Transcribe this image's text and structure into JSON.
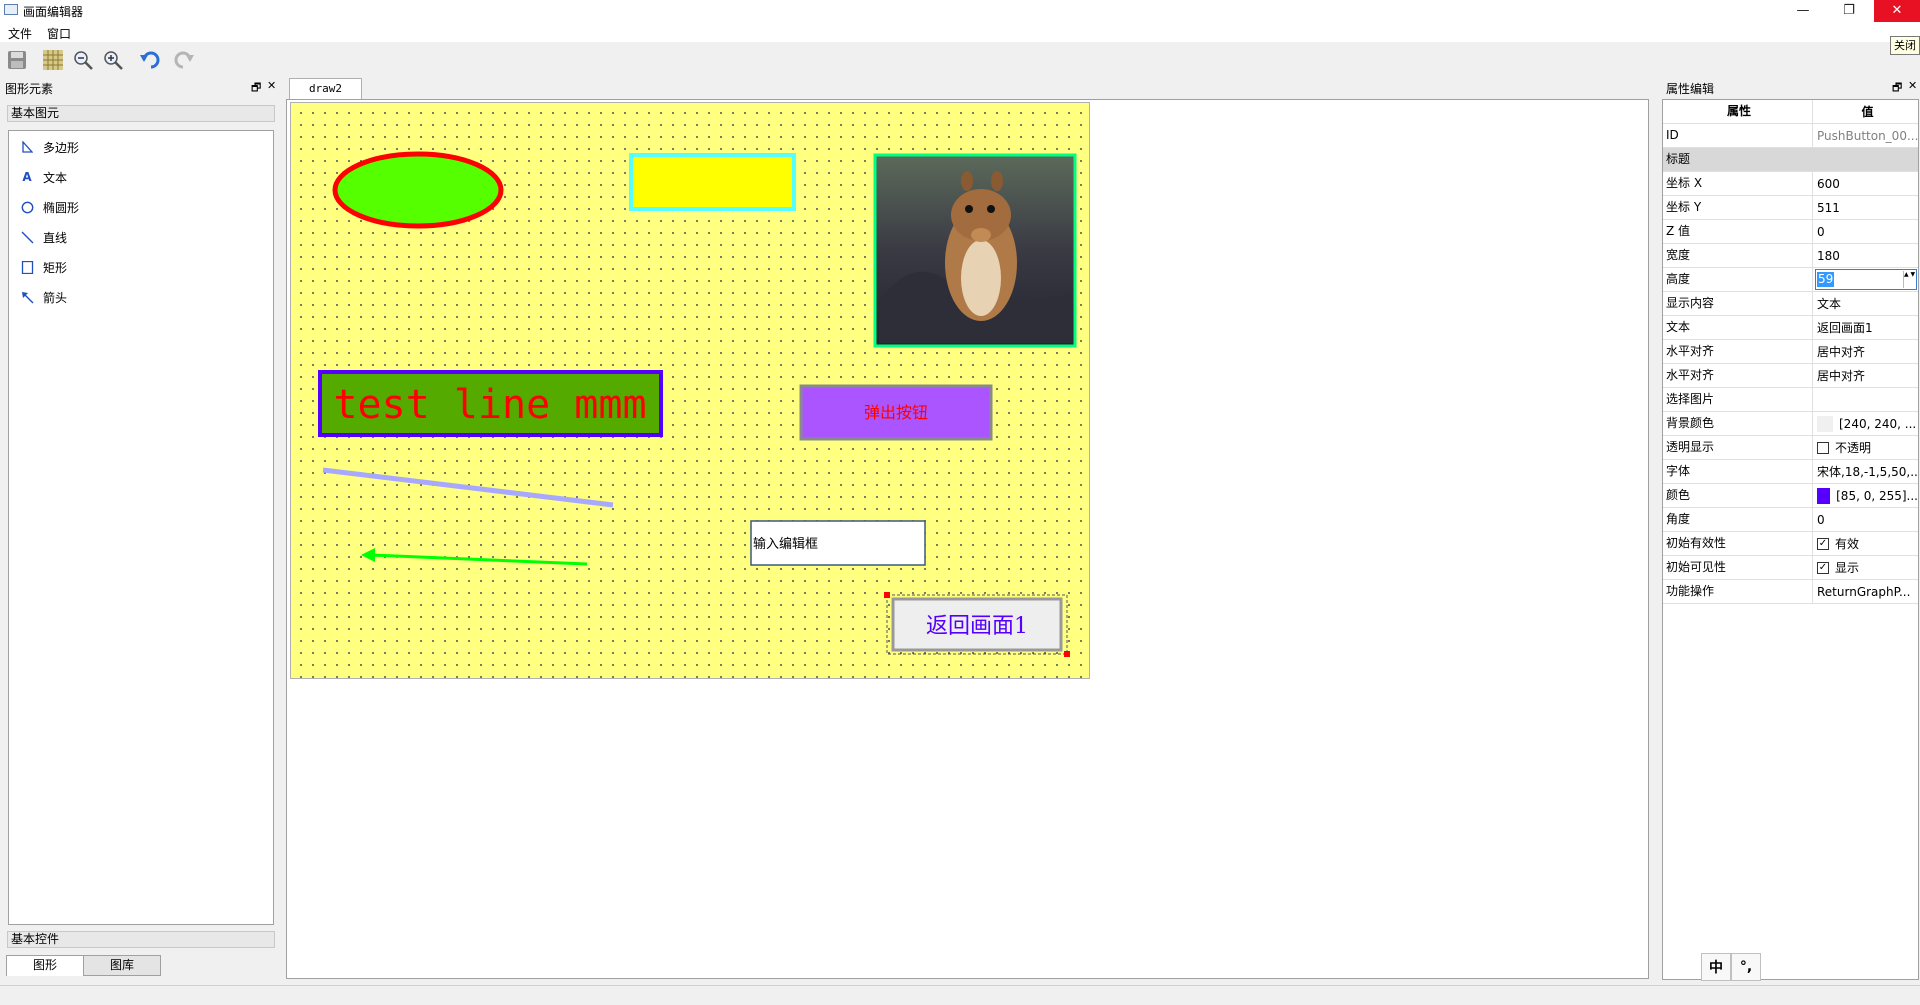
{
  "window": {
    "title": "画面编辑器",
    "minimize_glyph": "—",
    "restore_glyph": "❐",
    "close_glyph": "✕"
  },
  "menu": [
    "文件",
    "窗口"
  ],
  "toolbar": {
    "icons": [
      "save-icon",
      "grid-icon",
      "zoom-out-icon",
      "zoom-in-icon",
      "undo-icon",
      "redo-icon"
    ],
    "tooltip": "关闭"
  },
  "left_dock": {
    "title": "图形元素",
    "float_glyph": "🗗",
    "close_glyph": "✕",
    "section_basic_shapes": "基本图元",
    "shapes": [
      {
        "icon": "polygon-icon",
        "label": "多边形"
      },
      {
        "icon": "text-icon",
        "label": "文本"
      },
      {
        "icon": "ellipse-icon",
        "label": "椭圆形"
      },
      {
        "icon": "line-icon",
        "label": "直线"
      },
      {
        "icon": "rectangle-icon",
        "label": "矩形"
      },
      {
        "icon": "arrow-icon",
        "label": "箭头"
      }
    ],
    "section_basic_controls": "基本控件",
    "tabs": [
      "图形",
      "图库"
    ],
    "active_tab": "图形"
  },
  "editor": {
    "tab": "draw2",
    "canvas_bg": "#ffff80",
    "items": {
      "ellipse": {
        "fill": "#55ff00",
        "stroke": "#ff0000"
      },
      "rect": {
        "fill": "#ffff00",
        "stroke": "#55ffff"
      },
      "image": {
        "stroke": "#00ff7f"
      },
      "text_item": {
        "text": "test line mmm",
        "fill": "#55aa00",
        "stroke": "#5500ff",
        "color": "#ff0000"
      },
      "popup_button": {
        "text": "弹出按钮",
        "fill": "#aa55ff",
        "color": "#ff0000"
      },
      "line": {
        "stroke": "#a8a8ff"
      },
      "arrow": {
        "stroke": "#00ff00"
      },
      "input_box": {
        "text": "输入编辑框"
      },
      "return_button": {
        "text": "返回画面1",
        "color": "#5500ff"
      }
    }
  },
  "right_dock": {
    "title": "属性编辑",
    "float_glyph": "🗗",
    "close_glyph": "✕",
    "headers": {
      "name": "属性",
      "value": "值"
    },
    "properties": [
      {
        "name": "ID",
        "value": "PushButton_00..."
      },
      {
        "name": "标题",
        "value": "",
        "group": true
      },
      {
        "name": "坐标 X",
        "value": "600"
      },
      {
        "name": "坐标 Y",
        "value": "511"
      },
      {
        "name": "Z 值",
        "value": "0"
      },
      {
        "name": "宽度",
        "value": "180"
      },
      {
        "name": "高度",
        "value": "59",
        "editing": true
      },
      {
        "name": "显示内容",
        "value": "文本"
      },
      {
        "name": "文本",
        "value": "返回画面1"
      },
      {
        "name": "水平对齐",
        "value": "居中对齐"
      },
      {
        "name": "水平对齐",
        "value": "居中对齐"
      },
      {
        "name": "选择图片",
        "value": ""
      },
      {
        "name": "背景颜色",
        "value": "[240, 240, ...",
        "swatch": "#f0f0f0"
      },
      {
        "name": "透明显示",
        "value": "不透明",
        "checkbox": false
      },
      {
        "name": "字体",
        "value": "宋体,18,-1,5,50,..."
      },
      {
        "name": "颜色",
        "value": "[85, 0, 255]...",
        "swatch": "#5500ff"
      },
      {
        "name": "角度",
        "value": "0"
      },
      {
        "name": "初始有效性",
        "value": "有效",
        "checkbox": true
      },
      {
        "name": "初始可见性",
        "value": "显示",
        "checkbox": true
      },
      {
        "name": "功能操作",
        "value": "ReturnGraphP..."
      }
    ],
    "buttons": [
      "中",
      "°,"
    ]
  }
}
